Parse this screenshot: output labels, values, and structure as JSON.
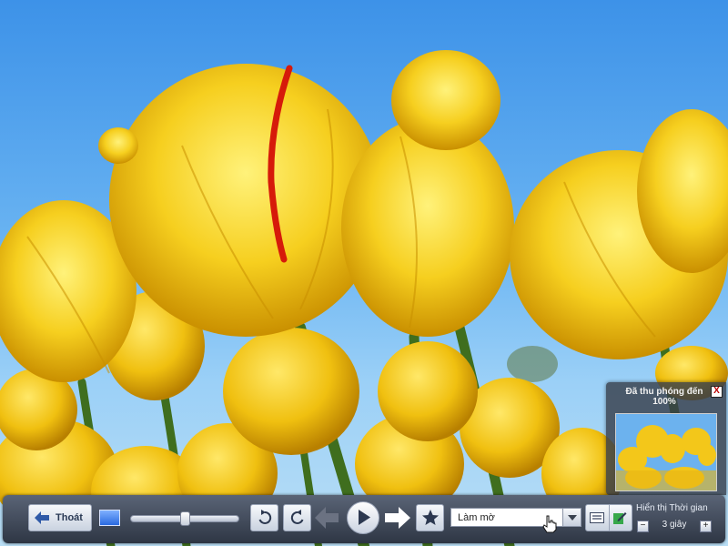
{
  "zoom": {
    "title": "Đã thu phóng đến",
    "level": "100%",
    "close": "X"
  },
  "toolbar": {
    "exit_label": "Thoát",
    "slider_value": 0.5,
    "effect": {
      "selected": "Làm mờ"
    },
    "timing": {
      "label": "Hiển thị Thời gian",
      "value": "3 giây",
      "minus": "−",
      "plus": "+"
    }
  },
  "icons": {
    "exit": "left-arrow-icon",
    "thumbnail": "thumbnail-view-icon",
    "rotate_left": "rotate-left-icon",
    "rotate_right": "rotate-right-icon",
    "previous": "previous-arrow-icon",
    "play": "play-icon",
    "next": "next-arrow-icon",
    "favorite": "star-icon",
    "subtitles": "caption-icon",
    "edit": "edit-icon"
  }
}
